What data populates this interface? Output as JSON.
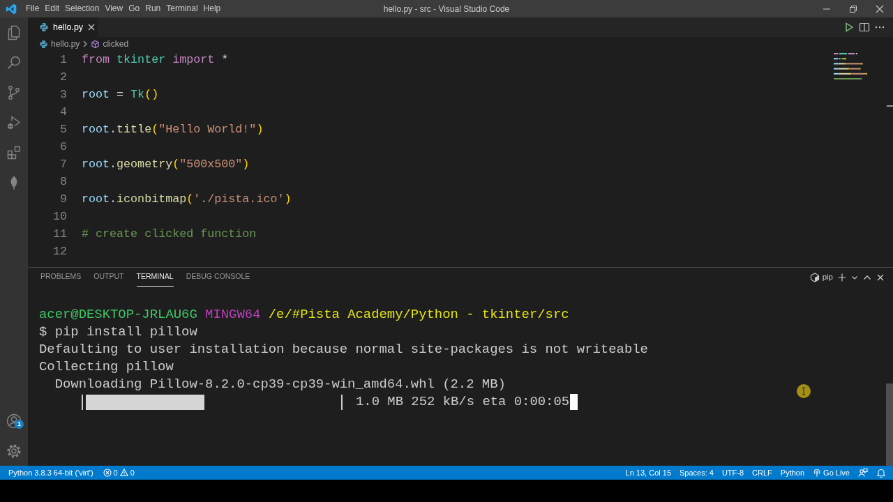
{
  "window": {
    "title": "hello.py - src - Visual Studio Code"
  },
  "menu": [
    "File",
    "Edit",
    "Selection",
    "View",
    "Go",
    "Run",
    "Terminal",
    "Help"
  ],
  "activity_bar": {
    "accounts_badge": "1"
  },
  "tabs": [
    {
      "label": "hello.py",
      "selected": true
    }
  ],
  "breadcrumb": [
    {
      "kind": "file",
      "label": "hello.py"
    },
    {
      "kind": "symbol",
      "label": "clicked"
    }
  ],
  "editor": {
    "lines": [
      {
        "number": "1",
        "tokens": [
          {
            "kind": "keyword",
            "text": "from"
          },
          {
            "kind": "class",
            "text": " tkinter"
          },
          {
            "kind": "keyword",
            "text": " import"
          },
          {
            "kind": "plain",
            "text": " *"
          }
        ]
      },
      {
        "number": "2"
      },
      {
        "number": "3",
        "tokens": [
          {
            "kind": "variable",
            "text": "root"
          },
          {
            "kind": "plain",
            "text": " = "
          },
          {
            "kind": "class",
            "text": "Tk"
          },
          {
            "kind": "bracket",
            "text": "()"
          }
        ]
      },
      {
        "number": "4"
      },
      {
        "number": "5",
        "tokens": [
          {
            "kind": "variable",
            "text": "root"
          },
          {
            "kind": "plain",
            "text": "."
          },
          {
            "kind": "function",
            "text": "title"
          },
          {
            "kind": "bracket",
            "text": "("
          },
          {
            "kind": "string",
            "text": "\"Hello World!\""
          },
          {
            "kind": "bracket",
            "text": ")"
          }
        ]
      },
      {
        "number": "6"
      },
      {
        "number": "7",
        "tokens": [
          {
            "kind": "variable",
            "text": "root"
          },
          {
            "kind": "plain",
            "text": "."
          },
          {
            "kind": "function",
            "text": "geometry"
          },
          {
            "kind": "bracket",
            "text": "("
          },
          {
            "kind": "string",
            "text": "\"500x500\""
          },
          {
            "kind": "bracket",
            "text": ")"
          }
        ]
      },
      {
        "number": "8"
      },
      {
        "number": "9",
        "tokens": [
          {
            "kind": "variable",
            "text": "root"
          },
          {
            "kind": "plain",
            "text": "."
          },
          {
            "kind": "function",
            "text": "iconbitmap"
          },
          {
            "kind": "bracket",
            "text": "("
          },
          {
            "kind": "string",
            "text": "'./pista.ico'"
          },
          {
            "kind": "bracket",
            "text": ")"
          }
        ]
      },
      {
        "number": "10"
      },
      {
        "number": "11",
        "tokens": [
          {
            "kind": "comment",
            "text": "# create clicked function"
          }
        ]
      },
      {
        "number": "12"
      }
    ]
  },
  "panel": {
    "tabs": [
      {
        "label": "PROBLEMS",
        "selected": false
      },
      {
        "label": "OUTPUT",
        "selected": false
      },
      {
        "label": "TERMINAL",
        "selected": true
      },
      {
        "label": "DEBUG CONSOLE",
        "selected": false
      }
    ],
    "shell": "pip"
  },
  "terminal": {
    "lines": [
      {
        "kind": "prompt",
        "segments": [
          {
            "kind": "user",
            "text": "acer@DESKTOP-JRLAU6G"
          },
          {
            "kind": "shell",
            "text": "MINGW64"
          },
          {
            "kind": "path",
            "text": "/e/#Pista Academy/Python - tkinter/src"
          }
        ]
      },
      {
        "kind": "command",
        "text": "$ pip install pillow"
      },
      {
        "kind": "output",
        "text": "Defaulting to user installation because normal site-packages is not writeable"
      },
      {
        "kind": "output",
        "text": "Collecting pillow"
      },
      {
        "kind": "detail",
        "text": "Downloading Pillow-8.2.0-cp39-cp39-win_amd64.whl (2.2 MB)"
      },
      {
        "kind": "progress",
        "level": 0.47,
        "reading": "1.0 MB 252 kB/s eta 0:00:05",
        "cursor": true
      }
    ]
  },
  "status_bar": {
    "interpreter": "Python 3.8.3 64-bit ('virt')",
    "errors": "0",
    "warnings": "0",
    "items": [
      "Ln 13, Col 15",
      "Spaces: 4",
      "UTF-8",
      "CRLF",
      "Python"
    ],
    "live": "Go Live"
  }
}
